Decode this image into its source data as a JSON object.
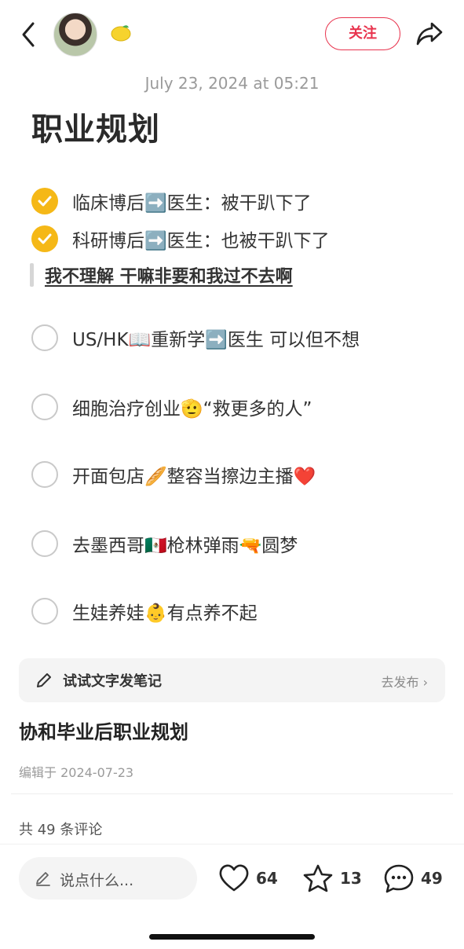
{
  "header": {
    "back_icon": "chevron-left-icon",
    "follow_label": "关注",
    "share_icon": "share-arrow-icon",
    "emoji_badge": "🍋"
  },
  "note": {
    "date": "July 23, 2024 at 05:21",
    "title": "职业规划",
    "tasks": [
      {
        "text": "临床博后➡️医生：被干趴下了",
        "done": true
      },
      {
        "text": "科研博后➡️医生：也被干趴下了",
        "done": true
      },
      {
        "text": "US/HK📖重新学➡️医生 可以但不想",
        "done": false
      },
      {
        "text": "细胞治疗创业🫡“救更多的人”",
        "done": false
      },
      {
        "text": "开面包店🥖整容当擦边主播❤️",
        "done": false
      },
      {
        "text": "去墨西哥🇲🇽枪林弹雨🔫圆梦",
        "done": false
      },
      {
        "text": "生娃养娃👶有点养不起",
        "done": false
      }
    ],
    "quote": "我不理解 干嘛非要和我过不去啊"
  },
  "write_banner": {
    "label": "试试文字发笔记",
    "action": "去发布 ›"
  },
  "post": {
    "title": "协和毕业后职业规划",
    "edited": "编辑于 2024-07-23",
    "comments_total": "共 49 条评论"
  },
  "bottom_bar": {
    "input_placeholder": "说点什么...",
    "likes": "64",
    "favorites": "13",
    "comments": "49"
  },
  "colors": {
    "accent_red": "#e8344e",
    "check_yellow": "#f5b817"
  }
}
